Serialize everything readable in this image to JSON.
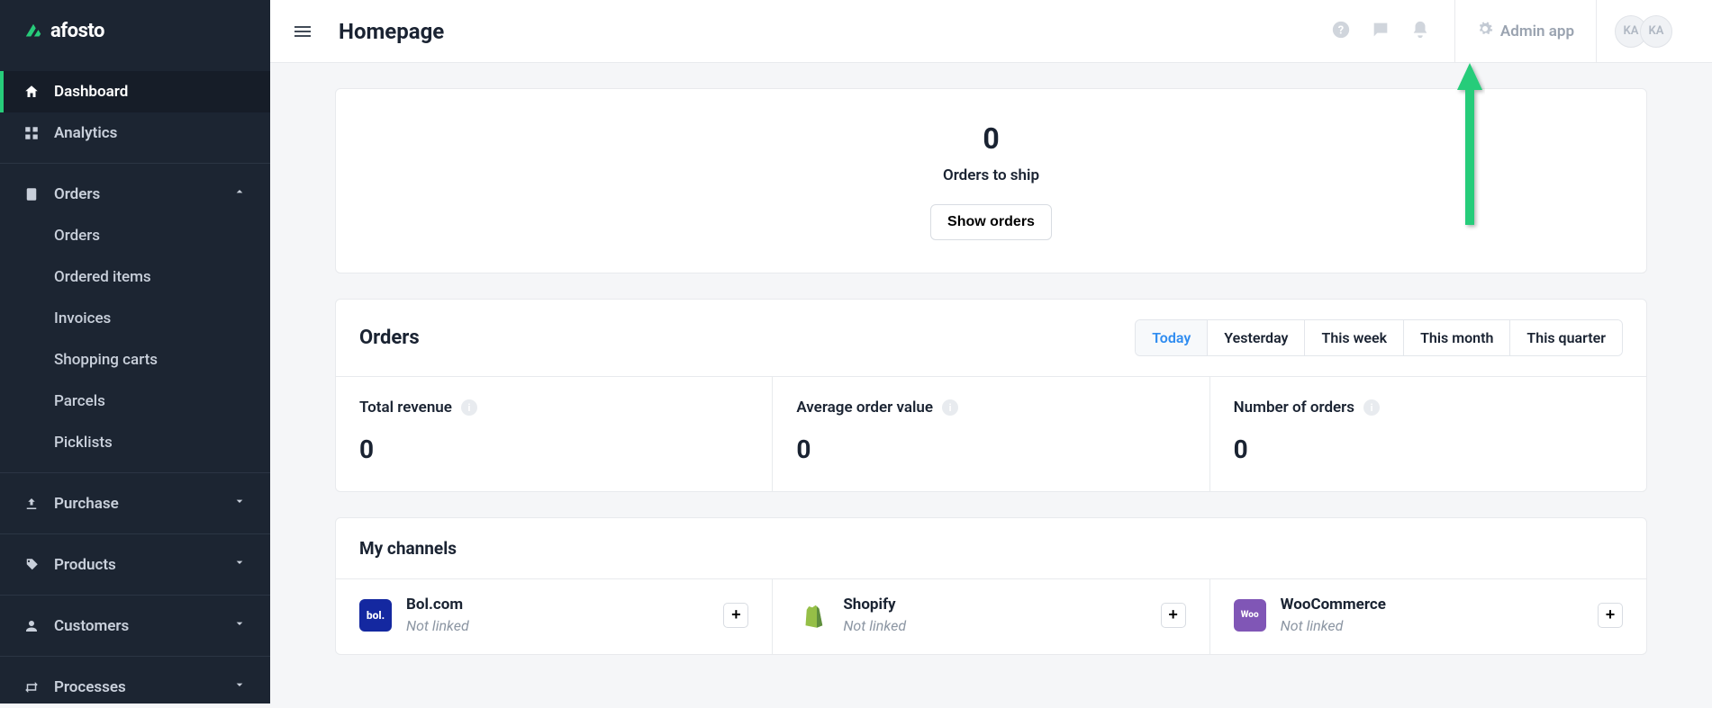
{
  "brand": {
    "name": "afosto"
  },
  "sidebar": {
    "items": [
      {
        "label": "Dashboard"
      },
      {
        "label": "Analytics"
      },
      {
        "label": "Orders"
      },
      {
        "label": "Purchase"
      },
      {
        "label": "Products"
      },
      {
        "label": "Customers"
      },
      {
        "label": "Processes"
      }
    ],
    "orders_sub": [
      {
        "label": "Orders"
      },
      {
        "label": "Ordered items"
      },
      {
        "label": "Invoices"
      },
      {
        "label": "Shopping carts"
      },
      {
        "label": "Parcels"
      },
      {
        "label": "Picklists"
      }
    ]
  },
  "header": {
    "title": "Homepage",
    "admin_label": "Admin app",
    "avatars": [
      "KA",
      "KA"
    ]
  },
  "ship": {
    "count": "0",
    "label": "Orders to ship",
    "button": "Show orders"
  },
  "orders": {
    "title": "Orders",
    "tabs": [
      {
        "label": "Today",
        "active": true
      },
      {
        "label": "Yesterday"
      },
      {
        "label": "This week"
      },
      {
        "label": "This month"
      },
      {
        "label": "This quarter"
      }
    ],
    "metrics": [
      {
        "label": "Total revenue",
        "value": "0"
      },
      {
        "label": "Average order value",
        "value": "0"
      },
      {
        "label": "Number of orders",
        "value": "0"
      }
    ]
  },
  "channels": {
    "title": "My channels",
    "list": [
      {
        "name": "Bol.com",
        "status": "Not linked",
        "logo_text": "bol.",
        "logo_bg": "#1428a0"
      },
      {
        "name": "Shopify",
        "status": "Not linked",
        "logo_bg": "transparent"
      },
      {
        "name": "WooCommerce",
        "status": "Not linked",
        "logo_text": "Woo",
        "logo_bg": "#8056b6"
      }
    ]
  }
}
